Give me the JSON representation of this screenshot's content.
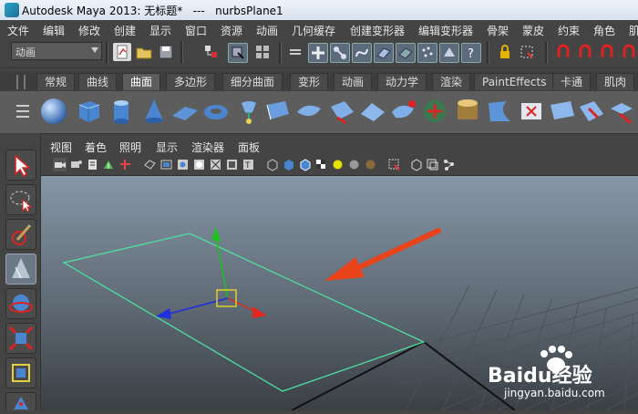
{
  "window": {
    "title": "Autodesk Maya 2013: 无标题*   ---   nurbsPlane1"
  },
  "menubar": {
    "items": [
      "文件",
      "编辑",
      "修改",
      "创建",
      "显示",
      "窗口",
      "资源",
      "动画",
      "几何缓存",
      "创建变形器",
      "编辑变形器",
      "骨架",
      "蒙皮",
      "约束",
      "角色",
      "肌"
    ]
  },
  "status": {
    "mode": "动画"
  },
  "shelf": {
    "tabs": [
      "常规",
      "曲线",
      "曲面",
      "多边形",
      "细分曲面",
      "变形",
      "动画",
      "动力学",
      "渲染",
      "PaintEffects",
      "卡通",
      "肌肉"
    ],
    "active_tab": "曲面"
  },
  "panel_menu": {
    "items": [
      "视图",
      "着色",
      "照明",
      "显示",
      "渲染器",
      "面板"
    ]
  },
  "colors": {
    "plane_outline": "#4de0a0",
    "axis_x": "#e0281c",
    "axis_y": "#19c41c",
    "axis_z": "#1f2fe0",
    "manip_center": "#f0e020",
    "annotation_arrow": "#e8431a",
    "viewport_top": "#8696a6",
    "viewport_bottom": "#3a3f44"
  },
  "watermark": {
    "brand": "Baidu经验",
    "url": "jingyan.baidu.com"
  }
}
